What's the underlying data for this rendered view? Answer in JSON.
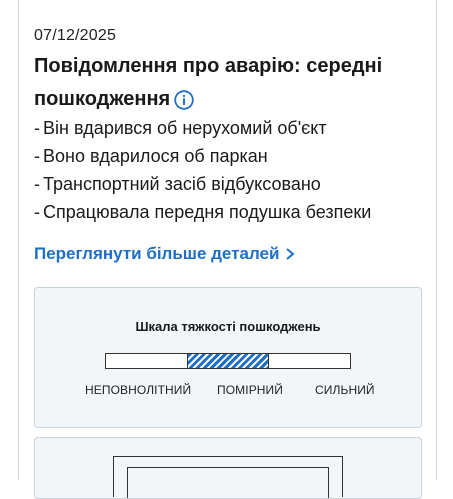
{
  "report": {
    "date": "07/12/2025",
    "title": "Повідомлення про аварію: середні пошкодження",
    "info_icon": "info-circle-icon",
    "details": [
      "Він вдарився об нерухомий об'єкт",
      "Воно вдарилося об паркан",
      "Транспортний засіб відбуксовано",
      "Спрацювала передня подушка безпеки"
    ],
    "more_link": "Переглянути більше деталей",
    "more_icon": "chevron-right-icon"
  },
  "severity": {
    "title": "Шкала тяжкості пошкоджень",
    "levels": [
      "НЕПОВНОЛІТНИЙ",
      "ПОМІРНИЙ",
      "СИЛЬНИЙ"
    ],
    "selected": "ПОМІРНИЙ",
    "accent": "#1f6fc5"
  },
  "colors": {
    "link": "#1f6fc5",
    "panel_bg": "#f3f6f8",
    "panel_border": "#c9d3da"
  }
}
